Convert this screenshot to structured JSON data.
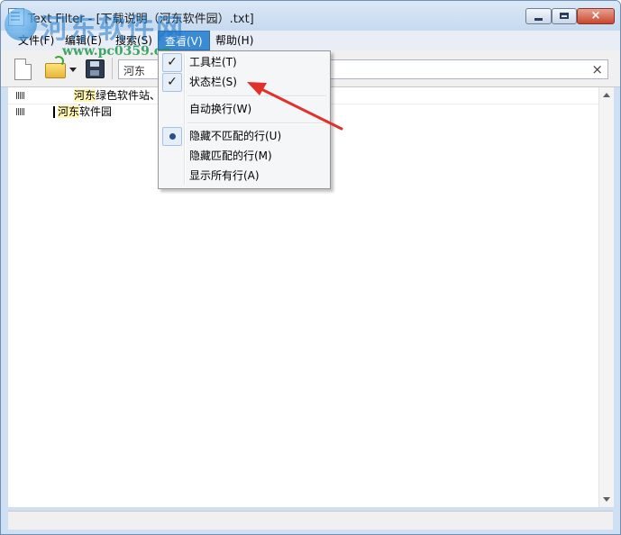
{
  "window": {
    "title": "Text Filter - [下载说明（河东软件园）.txt]",
    "controls": {
      "minimize": "minimize",
      "maximize": "maximize",
      "close": "×"
    }
  },
  "watermark": {
    "text": "河东软件网",
    "url": "www.pc0359.cn"
  },
  "menubar": {
    "items": [
      {
        "label": "文件(F)"
      },
      {
        "label": "编辑(E)"
      },
      {
        "label": "搜索(S)"
      },
      {
        "label": "查看(V)",
        "active": true
      },
      {
        "label": "帮助(H)"
      }
    ]
  },
  "toolbar": {
    "buttons": [
      "new-file-icon",
      "open-folder-icon",
      "dropdown-arrow-icon",
      "save-disk-icon"
    ],
    "search": {
      "value": "河东",
      "clear_label": "×"
    }
  },
  "editor": {
    "lines": [
      {
        "match": "河东",
        "rest": "绿色软件站、"
      },
      {
        "match": "河东",
        "rest": "软件园"
      }
    ]
  },
  "view_menu": {
    "items": [
      {
        "label": "工具栏(T)",
        "state": "checked",
        "mark": "✓"
      },
      {
        "label": "状态栏(S)",
        "state": "checked",
        "mark": "✓"
      },
      {
        "label": "自动换行(W)",
        "state": "none"
      },
      {
        "label": "隐藏不匹配的行(U)",
        "state": "radio-selected"
      },
      {
        "label": "隐藏匹配的行(M)",
        "state": "none"
      },
      {
        "label": "显示所有行(A)",
        "state": "none"
      }
    ]
  },
  "colors": {
    "menu_active": "#3a8ad4",
    "highlight": "#fff6b3",
    "annotation_arrow": "#e0322a"
  }
}
